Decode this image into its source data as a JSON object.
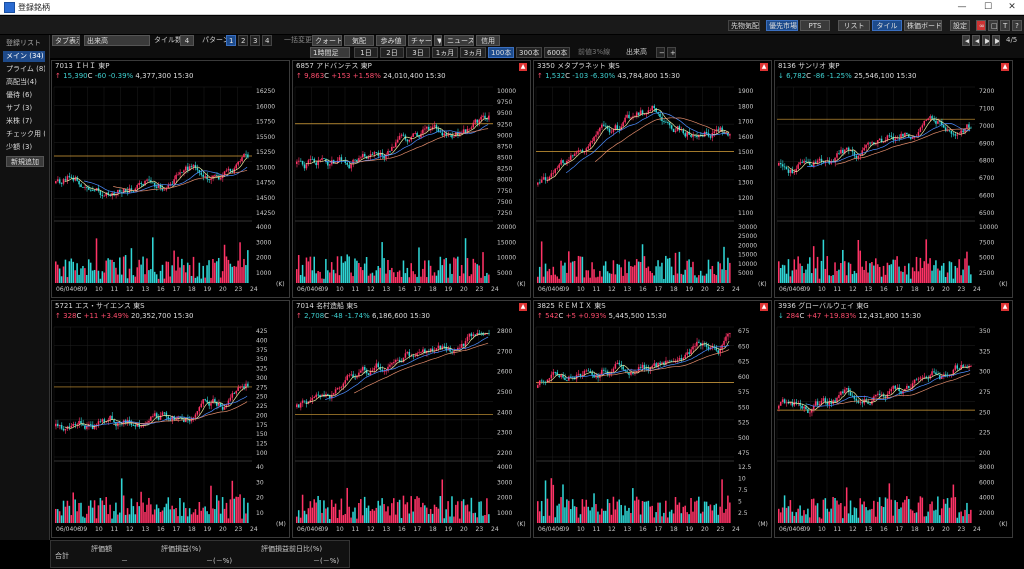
{
  "window": {
    "title": "登録銘柄"
  },
  "toolbar": {
    "tab_view": "タブ表示",
    "volume_select": "出来高",
    "tile_count_label": "タイル数",
    "tile_count": "4",
    "pattern_label": "パターン",
    "patterns": [
      "1",
      "2",
      "3",
      "4"
    ],
    "bulk_change": "一括変更",
    "quote": "クォート",
    "bid_ask": "気配",
    "tick": "歩み値",
    "chart": "チャート",
    "news": "ニュース",
    "credit": "信用",
    "timeframe": "1時間足",
    "ranges": [
      "1日",
      "2日",
      "3日",
      "1ヵ月",
      "3ヵ月",
      "100本",
      "300本",
      "600本"
    ],
    "prev_close_label": "前値3%線",
    "volume_label": "出来高",
    "right_buttons": [
      "先物気配",
      "優先市場",
      "PTS",
      "リスト",
      "タイル",
      "株価ボード",
      "設定"
    ],
    "page": "4/5"
  },
  "sidebar": {
    "header": "登録リスト",
    "items": [
      "メイン (34)",
      "プライム (8)",
      "高配当(4)",
      "優待 (6)",
      "サブ (3)",
      "米株 (7)",
      "チェック用 (",
      "少額 (3)"
    ],
    "add_button": "新規追加"
  },
  "panels": [
    {
      "code": "7013",
      "name": "ＩＨＩ",
      "market": "東P",
      "arrow": "↑",
      "price": "15,390",
      "flag": "C",
      "change": "-60",
      "pct": "-0.39%",
      "volume": "4,377,300",
      "time": "15:30",
      "dir": "down",
      "alert": false,
      "yticks": [
        "16250",
        "16000",
        "15750",
        "15500",
        "15250",
        "15000",
        "14750",
        "14500",
        "14250"
      ],
      "vticks": [
        "4000",
        "3000",
        "2000",
        "1000"
      ],
      "unit": "(K)"
    },
    {
      "code": "6857",
      "name": "アドバンテス",
      "market": "東P",
      "arrow": "↑",
      "price": "9,863",
      "flag": "C",
      "change": "+153",
      "pct": "+1.58%",
      "volume": "24,010,400",
      "time": "15:30",
      "dir": "up",
      "alert": true,
      "yticks": [
        "10000",
        "9750",
        "9500",
        "9250",
        "9000",
        "8750",
        "8500",
        "8250",
        "8000",
        "7750",
        "7500",
        "7250"
      ],
      "vticks": [
        "20000",
        "15000",
        "10000",
        "5000"
      ],
      "unit": "(K)"
    },
    {
      "code": "3350",
      "name": "メタプラネット",
      "market": "東S",
      "arrow": "↑",
      "price": "1,532",
      "flag": "C",
      "change": "-103",
      "pct": "-6.30%",
      "volume": "43,784,800",
      "time": "15:30",
      "dir": "down",
      "alert": true,
      "yticks": [
        "1900",
        "1800",
        "1700",
        "1600",
        "1500",
        "1400",
        "1300",
        "1200",
        "1100"
      ],
      "vticks": [
        "30000",
        "25000",
        "20000",
        "15000",
        "10000",
        "5000"
      ],
      "unit": "(K)"
    },
    {
      "code": "8136",
      "name": "サンリオ",
      "market": "東P",
      "arrow": "↓",
      "price": "6,782",
      "flag": "C",
      "change": "-86",
      "pct": "-1.25%",
      "volume": "25,546,100",
      "time": "15:30",
      "dir": "down",
      "alert": true,
      "yticks": [
        "7200",
        "7100",
        "7000",
        "6900",
        "6800",
        "6700",
        "6600",
        "6500"
      ],
      "vticks": [
        "10000",
        "7500",
        "5000",
        "2500"
      ],
      "unit": "(K)"
    },
    {
      "code": "5721",
      "name": "エス・サイエンス",
      "market": "東S",
      "arrow": "↑",
      "price": "328",
      "flag": "C",
      "change": "+11",
      "pct": "+3.49%",
      "volume": "20,352,700",
      "time": "15:30",
      "dir": "up",
      "alert": false,
      "yticks": [
        "425",
        "400",
        "375",
        "350",
        "325",
        "300",
        "275",
        "250",
        "225",
        "200",
        "175",
        "150",
        "125",
        "100"
      ],
      "vticks": [
        "40",
        "30",
        "20",
        "10"
      ],
      "unit": "(M)"
    },
    {
      "code": "7014",
      "name": "名村造船",
      "market": "東S",
      "arrow": "↑",
      "price": "2,708",
      "flag": "C",
      "change": "-48",
      "pct": "-1.74%",
      "volume": "6,186,600",
      "time": "15:30",
      "dir": "down",
      "alert": true,
      "yticks": [
        "2800",
        "2700",
        "2600",
        "2500",
        "2400",
        "2300",
        "2200"
      ],
      "vticks": [
        "4000",
        "3000",
        "2000",
        "1000"
      ],
      "unit": "(K)"
    },
    {
      "code": "3825",
      "name": "ＲＥＭＩＸ",
      "market": "東S",
      "arrow": "↑",
      "price": "542",
      "flag": "C",
      "change": "+5",
      "pct": "+0.93%",
      "volume": "5,445,500",
      "time": "15:30",
      "dir": "up",
      "alert": true,
      "yticks": [
        "675",
        "650",
        "625",
        "600",
        "575",
        "550",
        "525",
        "500",
        "475"
      ],
      "vticks": [
        "12.5",
        "10",
        "7.5",
        "5",
        "2.5"
      ],
      "unit": "(M)"
    },
    {
      "code": "3936",
      "name": "グローバルウェイ",
      "market": "東G",
      "arrow": "↓",
      "price": "284",
      "flag": "C",
      "change": "+47",
      "pct": "+19.83%",
      "volume": "12,431,800",
      "time": "15:30",
      "dir": "up",
      "alert": true,
      "yticks": [
        "350",
        "325",
        "300",
        "275",
        "250",
        "225",
        "200"
      ],
      "vticks": [
        "8000",
        "6000",
        "4000",
        "2000"
      ],
      "unit": "(K)"
    }
  ],
  "xticks": [
    "06/0406",
    "09",
    "10",
    "11",
    "12",
    "13",
    "16",
    "17",
    "18",
    "19",
    "20",
    "23",
    "24"
  ],
  "footer": {
    "total_label": "合計",
    "col1": "評価額",
    "col2": "評価損益(%)",
    "col3": "評価損益前日比(%)",
    "v1": "－",
    "v2": "－(－%)",
    "v3": "－(－%)"
  }
}
